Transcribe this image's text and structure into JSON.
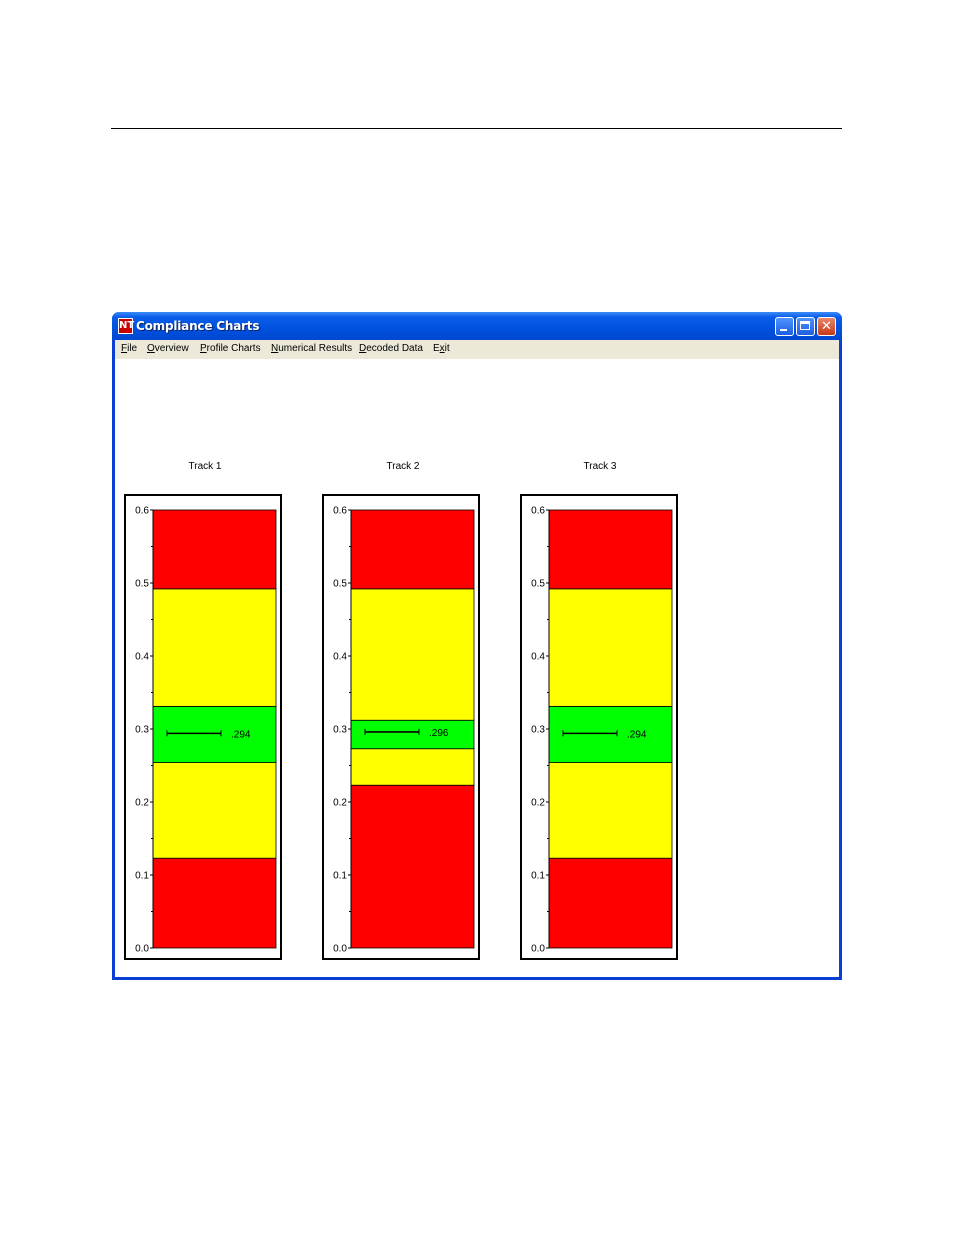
{
  "window": {
    "title": "Compliance Charts",
    "icon_name": "nt-app-icon",
    "icon_text": "NT"
  },
  "menu": [
    {
      "label": "File",
      "accel": "F",
      "rest": "ile"
    },
    {
      "label": "Overview",
      "accel": "O",
      "rest": "verview"
    },
    {
      "label": "Profile Charts",
      "accel": "P",
      "rest": "rofile Charts"
    },
    {
      "label": "Numerical Results",
      "accel": "N",
      "rest": "umerical Results"
    },
    {
      "label": "Decoded Data",
      "accel": "D",
      "rest": "ecoded Data"
    },
    {
      "label": "Exit",
      "pre": "E",
      "accel": "x",
      "rest": "it"
    }
  ],
  "colors": {
    "red": "#ff0000",
    "yellow": "#ffff00",
    "green": "#00ff00",
    "title_bar": "#0052e0",
    "window_border": "#0a3fd6",
    "menu_bg": "#ece9d8"
  },
  "chart_data": [
    {
      "type": "bar",
      "title": "Track 1",
      "ylim": [
        0,
        0.6
      ],
      "y_ticks": [
        "0.0",
        "0.1",
        "0.2",
        "0.3",
        "0.4",
        "0.5",
        "0.6"
      ],
      "bands": [
        {
          "from": 0.0,
          "to": 0.123,
          "color": "red"
        },
        {
          "from": 0.123,
          "to": 0.254,
          "color": "yellow"
        },
        {
          "from": 0.254,
          "to": 0.331,
          "color": "green"
        },
        {
          "from": 0.331,
          "to": 0.492,
          "color": "yellow"
        },
        {
          "from": 0.492,
          "to": 0.6,
          "color": "red"
        }
      ],
      "measurement": {
        "value": 0.294,
        "label": ".294"
      }
    },
    {
      "type": "bar",
      "title": "Track 2",
      "ylim": [
        0,
        0.6
      ],
      "y_ticks": [
        "0.0",
        "0.1",
        "0.2",
        "0.3",
        "0.4",
        "0.5",
        "0.6"
      ],
      "bands": [
        {
          "from": 0.0,
          "to": 0.223,
          "color": "red"
        },
        {
          "from": 0.223,
          "to": 0.273,
          "color": "yellow"
        },
        {
          "from": 0.273,
          "to": 0.312,
          "color": "green"
        },
        {
          "from": 0.312,
          "to": 0.492,
          "color": "yellow"
        },
        {
          "from": 0.492,
          "to": 0.6,
          "color": "red"
        }
      ],
      "measurement": {
        "value": 0.296,
        "label": ".296"
      }
    },
    {
      "type": "bar",
      "title": "Track 3",
      "ylim": [
        0,
        0.6
      ],
      "y_ticks": [
        "0.0",
        "0.1",
        "0.2",
        "0.3",
        "0.4",
        "0.5",
        "0.6"
      ],
      "bands": [
        {
          "from": 0.0,
          "to": 0.123,
          "color": "red"
        },
        {
          "from": 0.123,
          "to": 0.254,
          "color": "yellow"
        },
        {
          "from": 0.254,
          "to": 0.331,
          "color": "green"
        },
        {
          "from": 0.331,
          "to": 0.492,
          "color": "yellow"
        },
        {
          "from": 0.492,
          "to": 0.6,
          "color": "red"
        }
      ],
      "measurement": {
        "value": 0.294,
        "label": ".294"
      }
    }
  ]
}
